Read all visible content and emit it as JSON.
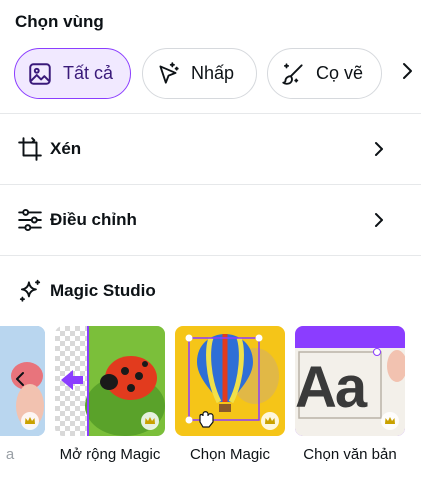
{
  "header": {
    "title": "Chọn vùng"
  },
  "chips": [
    {
      "label": "Tất cả",
      "icon": "image-icon",
      "active": true
    },
    {
      "label": "Nhấp",
      "icon": "magic-cursor-icon",
      "active": false
    },
    {
      "label": "Cọ vẽ",
      "icon": "magic-brush-icon",
      "active": false
    }
  ],
  "rows": {
    "crop": {
      "label": "Xén",
      "icon": "crop-icon"
    },
    "adjust": {
      "label": "Điều chỉnh",
      "icon": "sliders-icon"
    }
  },
  "magic": {
    "title": "Magic Studio",
    "tiles": [
      {
        "label": "a"
      },
      {
        "label": "Mở rộng Magic"
      },
      {
        "label": "Chọn Magic"
      },
      {
        "label": "Chọn văn bản"
      }
    ],
    "text_tile_glyphs": "Aa"
  },
  "colors": {
    "accent": "#8b3dff",
    "accent_bg": "#f1e9ff",
    "divider": "#e6e8ea",
    "crown": "#c9a100"
  }
}
